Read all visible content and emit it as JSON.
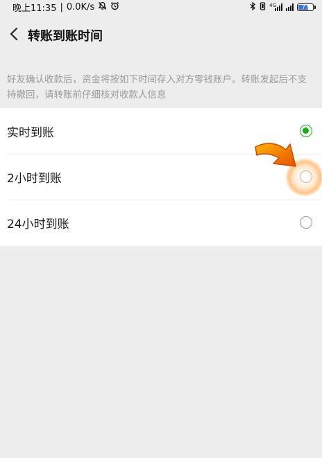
{
  "status_bar": {
    "time": "晚上11:35",
    "speed": "0.0K/s",
    "network_badge": "4G",
    "battery_level": "77",
    "icons": [
      "mute-bell-icon",
      "alarm-icon",
      "bluetooth-icon",
      "vibrate-icon",
      "signal-icon",
      "battery-icon"
    ]
  },
  "nav": {
    "title": "转账到账时间",
    "back_icon": "chevron-left-icon"
  },
  "notice": "好友确认收款后，资金将按如下时间存入对方零钱账户。转账发起后不支持撤回，请转账前仔细核对收款人信息",
  "options": [
    {
      "label": "实时到账",
      "selected": true
    },
    {
      "label": "2小时到账",
      "selected": false
    },
    {
      "label": "24小时到账",
      "selected": false
    }
  ],
  "colors": {
    "accent_green": "#1aad19",
    "annotation_orange": "#f57c00",
    "page_background": "#ededed"
  }
}
